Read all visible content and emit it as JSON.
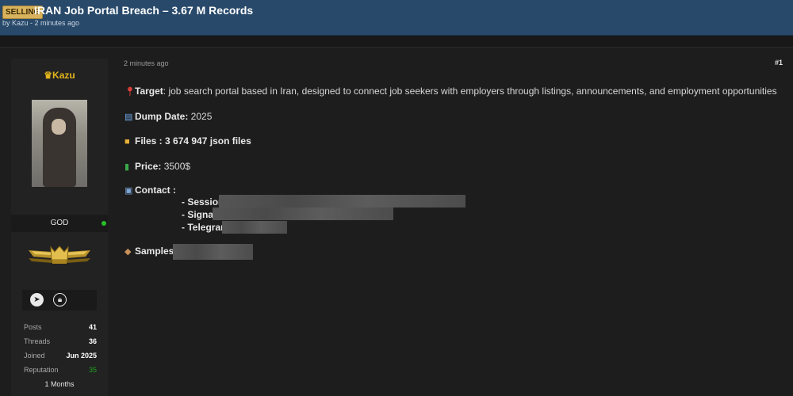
{
  "header": {
    "badge": "SELLING",
    "title": "IRAN Job Portal Breach – 3.67 M Records",
    "meta": "by Kazu - 2 minutes ago"
  },
  "user": {
    "name": "♛Kazu",
    "role": "GOD",
    "stats": [
      {
        "label": "Posts",
        "value": "41"
      },
      {
        "label": "Threads",
        "value": "36"
      },
      {
        "label": "Joined",
        "value": "Jun 2025"
      },
      {
        "label": "Reputation",
        "value": "35"
      }
    ],
    "months": "1 Months",
    "social_icons": [
      "telegram-icon",
      "lock-icon"
    ]
  },
  "post": {
    "time": "2 minutes ago",
    "number": "#1",
    "target_label": "Target",
    "target_text": ":  job search portal based in Iran, designed to connect job seekers with employers through listings, announcements, and employment opportunities",
    "dump_label": "Dump Date:",
    "dump_value": " 2025",
    "files_label": "Files : 3 674 947 json files",
    "price_label": "Price:",
    "price_value": " 3500$",
    "contact_label": "Contact :",
    "session_label": "- Session :",
    "signal_label": "- Signal :",
    "telegram_label": "- Telegram :",
    "samples_label": "Samples :",
    "icons": {
      "target": "pin-icon",
      "dump": "calendar-icon",
      "files": "folder-icon",
      "price": "money-icon",
      "contact": "contact-icon",
      "samples": "package-icon"
    }
  },
  "colors": {
    "header_bg": "#28496a",
    "badge_bg": "#d8b25c",
    "username": "#e3b51d",
    "online": "#25c225",
    "reputation": "#20a020"
  }
}
